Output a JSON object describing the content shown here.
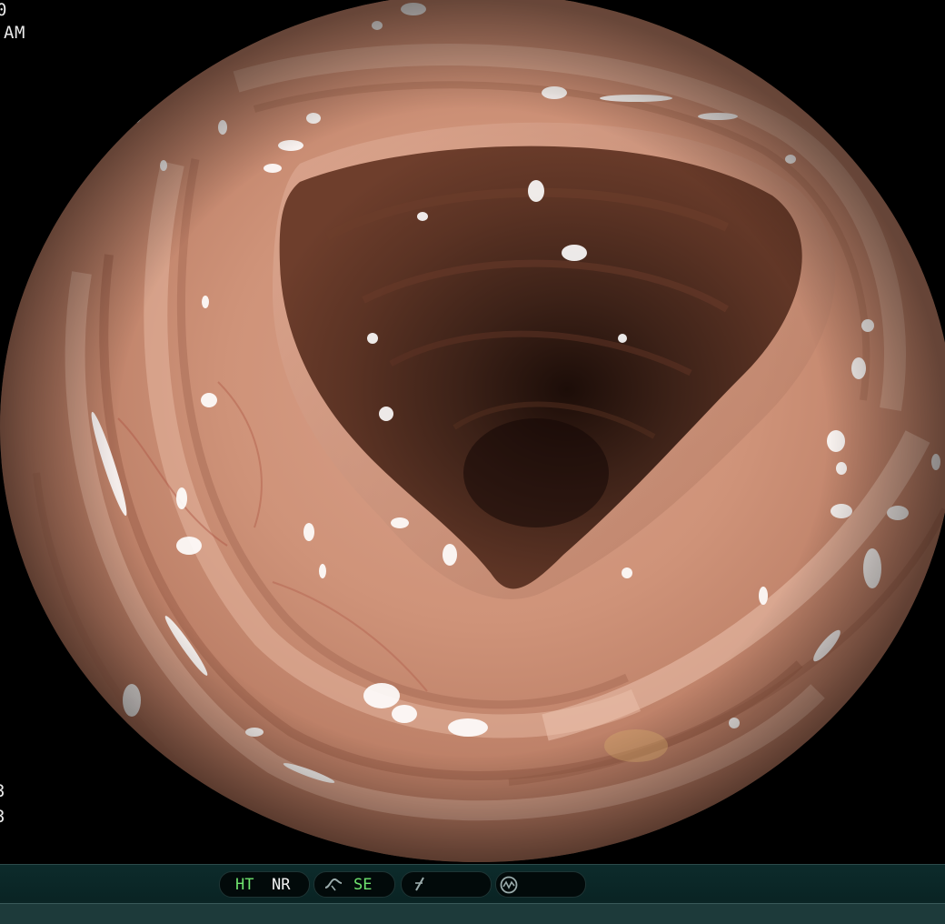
{
  "overlay": {
    "top_left_line1": "0",
    "top_left_line2": "AM",
    "bottom_left_line1": "3",
    "bottom_left_line2": "3"
  },
  "status_bar": {
    "hdtv_label": "HT",
    "noise_reduction_label": "NR",
    "structure_enhancement_icon": "tone-curve-icon",
    "structure_enhancement_label": "SE",
    "freeze_icon": "f-slash-icon",
    "waveform_icon": "waveform-circle-icon"
  },
  "colors": {
    "background": "#000000",
    "mucosa": "#c48a72",
    "lumen": "#3a2117",
    "status_green": "#6fe36f",
    "status_bar": "#0c2b2b"
  }
}
